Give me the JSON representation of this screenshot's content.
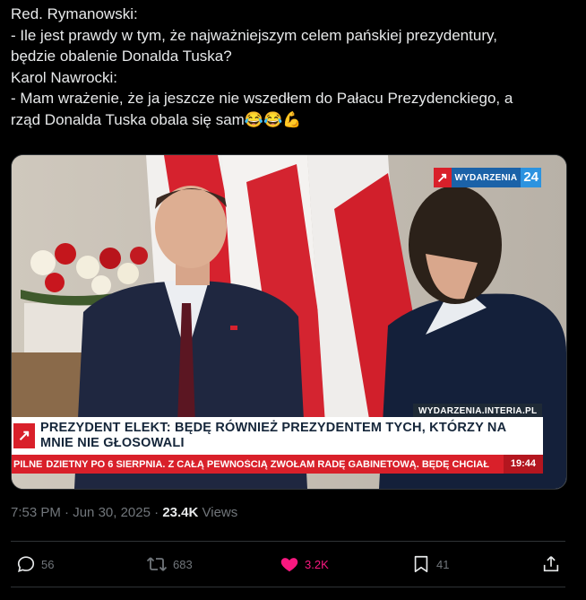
{
  "tweet": {
    "lines": [
      "Red. Rymanowski:",
      "- Ile jest prawdy w tym, że najważniejszym celem pańskiej prezydentury,",
      "będzie obalenie Donalda Tuska?",
      "Karol Nawrocki:",
      "- Mam wrażenie, że ja jeszcze nie wszedłem do Pałacu Prezydenckiego, a",
      "rząd Donalda Tuska obala się sam😂😂💪"
    ]
  },
  "media": {
    "brand_mark": "↗",
    "brand_name": "WYDARZENIA",
    "brand_number": "24",
    "site_label": "WYDARZENIA.INTERIA.PL",
    "headline": "PREZYDENT ELEKT: BĘDĘ RÓWNIEŻ PREZYDENTEM TYCH, KTÓRZY NA MNIE NIE GŁOSOWALI",
    "ticker_label": "PILNE",
    "ticker_text": "DZIETNY PO 6 SIERPNIA. Z CAŁĄ PEWNOŚCIĄ ZWOŁAM RADĘ GABINETOWĄ. BĘDĘ CHCIAŁ",
    "ticker_time": "19:44"
  },
  "meta": {
    "time": "7:53 PM",
    "separator": "·",
    "date": "Jun 30, 2025",
    "views_count": "23.4K",
    "views_label": "Views"
  },
  "actions": {
    "replies": "56",
    "reposts": "683",
    "likes": "3.2K",
    "bookmarks": "41"
  },
  "colors": {
    "background": "#000000",
    "text": "#e7e9ea",
    "muted": "#71767b",
    "like": "#f91880",
    "border": "#2f3336"
  }
}
